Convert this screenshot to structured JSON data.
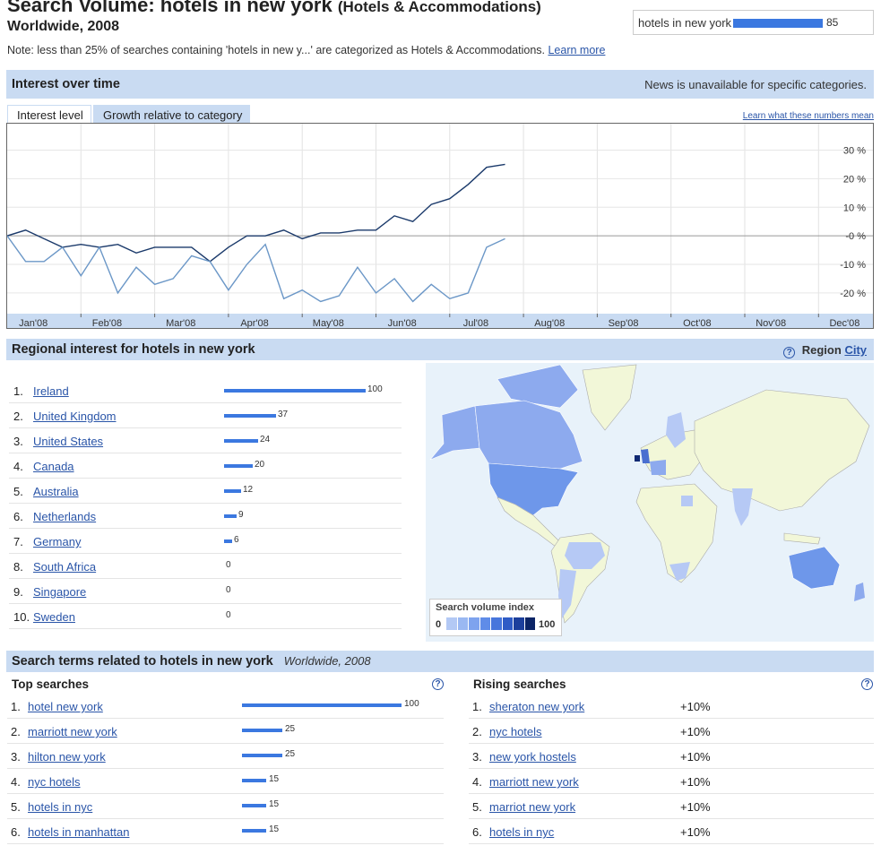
{
  "header": {
    "title": "Search Volume: hotels in new york",
    "category": "(Hotels & Accommodations)",
    "subtitle": "Worldwide, 2008",
    "legend_term": "hotels in new york",
    "legend_value": "85",
    "note": "Note: less than 25% of searches containing 'hotels in new y...' are categorized as Hotels & Accommodations.",
    "learn_more": "Learn more"
  },
  "interest": {
    "title": "Interest over time",
    "news_note": "News is unavailable for specific categories.",
    "tabs": [
      "Interest level",
      "Growth relative to category"
    ],
    "learn_numbers": "Learn what these numbers mean"
  },
  "chart_data": {
    "type": "line",
    "x_ticks": [
      "Jan'08",
      "Feb'08",
      "Mar'08",
      "Apr'08",
      "May'08",
      "Jun'08",
      "Jul'08",
      "Aug'08",
      "Sep'08",
      "Oct'08",
      "Nov'08",
      "Dec'08"
    ],
    "y_ticks": [
      "30 %",
      "20 %",
      "10 %",
      "-0 %",
      "-10 %",
      "-20 %"
    ],
    "ylim": [
      -26,
      33
    ],
    "series": [
      {
        "color": "#1b3a6b",
        "x": [
          0,
          0.25,
          0.5,
          0.75,
          1.0,
          1.25,
          1.5,
          1.75,
          2.0,
          2.25,
          2.5,
          2.75,
          3.0,
          3.25,
          3.5,
          3.75,
          4.0,
          4.25,
          4.5,
          4.75,
          5.0,
          5.25,
          5.5,
          5.75,
          6.0,
          6.25,
          6.5,
          6.75
        ],
        "values": [
          0,
          2,
          -1,
          -4,
          -3,
          -4,
          -3,
          -6,
          -4,
          -4,
          -4,
          -9,
          -4,
          0,
          0,
          2,
          -1,
          1,
          1,
          2,
          2,
          7,
          5,
          11,
          13,
          18,
          24,
          25
        ]
      },
      {
        "color": "#6b97c7",
        "x": [
          0,
          0.25,
          0.5,
          0.75,
          1.0,
          1.25,
          1.5,
          1.75,
          2.0,
          2.25,
          2.5,
          2.75,
          3.0,
          3.25,
          3.5,
          3.75,
          4.0,
          4.25,
          4.5,
          4.75,
          5.0,
          5.25,
          5.5,
          5.75,
          6.0,
          6.25,
          6.5,
          6.75
        ],
        "values": [
          0,
          -9,
          -9,
          -4,
          -14,
          -4,
          -20,
          -11,
          -17,
          -15,
          -7,
          -9,
          -19,
          -10,
          -3,
          -22,
          -19,
          -23,
          -21,
          -11,
          -20,
          -15,
          -23,
          -17,
          -22,
          -20,
          -4,
          -1
        ]
      }
    ]
  },
  "regional": {
    "title": "Regional interest  for hotels in new york",
    "region_label": "Region",
    "city_link": "City",
    "rows": [
      {
        "rank": "1.",
        "name": "Ireland",
        "value": "100"
      },
      {
        "rank": "2.",
        "name": "United Kingdom",
        "value": "37"
      },
      {
        "rank": "3.",
        "name": "United States",
        "value": "24"
      },
      {
        "rank": "4.",
        "name": "Canada",
        "value": "20"
      },
      {
        "rank": "5.",
        "name": "Australia",
        "value": "12"
      },
      {
        "rank": "6.",
        "name": "Netherlands",
        "value": "9"
      },
      {
        "rank": "7.",
        "name": "Germany",
        "value": "6"
      },
      {
        "rank": "8.",
        "name": "South Africa",
        "value": "0"
      },
      {
        "rank": "9.",
        "name": "Singapore",
        "value": "0"
      },
      {
        "rank": "10.",
        "name": "Sweden",
        "value": "0"
      }
    ],
    "map_legend": {
      "title": "Search volume index",
      "min": "0",
      "max": "100"
    }
  },
  "related": {
    "title": "Search terms related to hotels in new york",
    "scope": "Worldwide, 2008",
    "top_title": "Top searches",
    "rising_title": "Rising searches",
    "top": [
      {
        "rank": "1.",
        "term": "hotel new york",
        "value": "100"
      },
      {
        "rank": "2.",
        "term": "marriott new york",
        "value": "25"
      },
      {
        "rank": "3.",
        "term": "hilton new york",
        "value": "25"
      },
      {
        "rank": "4.",
        "term": "nyc hotels",
        "value": "15"
      },
      {
        "rank": "5.",
        "term": "hotels in nyc",
        "value": "15"
      },
      {
        "rank": "6.",
        "term": "hotels in manhattan",
        "value": "15"
      }
    ],
    "rising": [
      {
        "rank": "1.",
        "term": "sheraton new york",
        "value": "+10%"
      },
      {
        "rank": "2.",
        "term": "nyc hotels",
        "value": "+10%"
      },
      {
        "rank": "3.",
        "term": "new york hostels",
        "value": "+10%"
      },
      {
        "rank": "4.",
        "term": "marriott new york",
        "value": "+10%"
      },
      {
        "rank": "5.",
        "term": "marriot new york",
        "value": "+10%"
      },
      {
        "rank": "6.",
        "term": "hotels in nyc",
        "value": "+10%"
      }
    ]
  },
  "colors": {
    "accent_bar": "#3b78e0",
    "section_bar": "#c9dbf2",
    "link": "#2a55a8",
    "line_primary": "#1b3a6b",
    "line_secondary": "#6b97c7",
    "map_scale": [
      "#b3c9f5",
      "#9ab8f2",
      "#7ea3ee",
      "#5f8ce8",
      "#4776dc",
      "#2f5cc6",
      "#1c3f9c",
      "#0b2466"
    ]
  }
}
